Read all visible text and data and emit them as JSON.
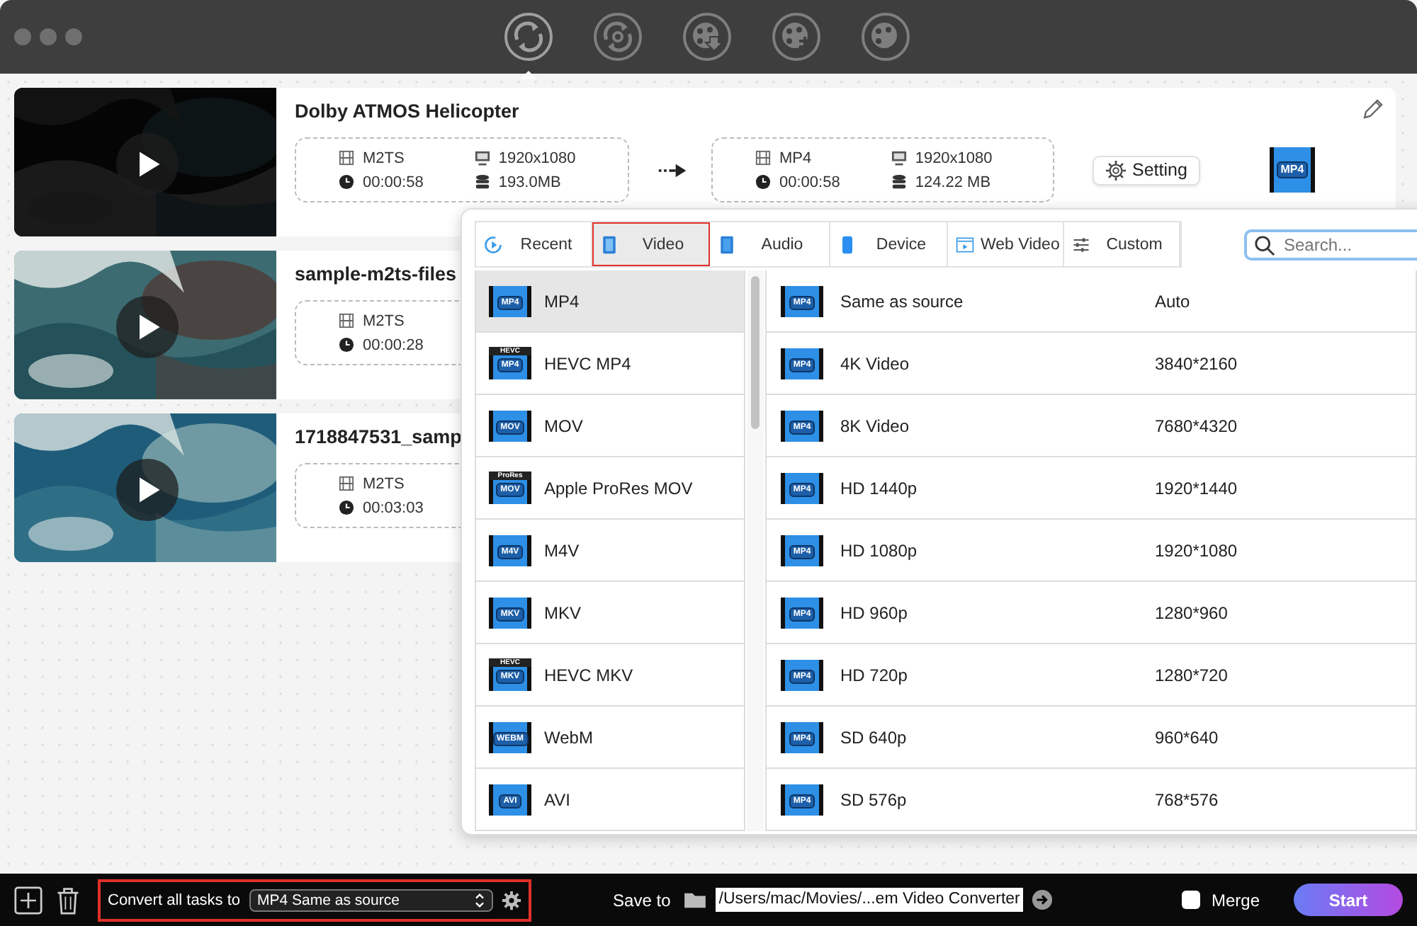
{
  "toolbar": [
    {
      "kind": "convert",
      "selected": true
    },
    {
      "kind": "compress",
      "selected": false
    },
    {
      "kind": "download",
      "selected": false
    },
    {
      "kind": "merge",
      "selected": false
    },
    {
      "kind": "edit",
      "selected": false
    }
  ],
  "tasks": [
    {
      "title": "Dolby ATMOS Helicopter",
      "source": {
        "format": "M2TS",
        "duration": "00:00:58",
        "resolution": "1920x1080",
        "size": "193.0MB"
      },
      "target": {
        "format": "MP4",
        "duration": "00:00:58",
        "resolution": "1920x1080",
        "size": "124.22 MB",
        "setting": "Setting",
        "badge": "MP4"
      }
    },
    {
      "title": "sample-m2ts-files",
      "source": {
        "format": "M2TS",
        "duration": "00:00:28"
      }
    },
    {
      "title": "1718847531_samp",
      "source": {
        "format": "M2TS",
        "duration": "00:03:03"
      }
    }
  ],
  "format_panel": {
    "tabs": [
      {
        "kind": "recent",
        "label": "Recent",
        "selected": false
      },
      {
        "kind": "video",
        "label": "Video",
        "selected": true
      },
      {
        "kind": "audio",
        "label": "Audio",
        "selected": false
      },
      {
        "kind": "device",
        "label": "Device",
        "selected": false
      },
      {
        "kind": "web",
        "label": "Web Video",
        "selected": false
      },
      {
        "kind": "custom",
        "label": "Custom",
        "selected": false
      }
    ],
    "search": {
      "placeholder": "Search..."
    },
    "formats": [
      {
        "name": "MP4",
        "badge": "MP4",
        "selected": true
      },
      {
        "name": "HEVC MP4",
        "badge": "MP4",
        "badge_top": "HEVC",
        "selected": false
      },
      {
        "name": "MOV",
        "badge": "MOV",
        "selected": false
      },
      {
        "name": "Apple ProRes MOV",
        "badge": "MOV",
        "badge_top": "ProRes",
        "selected": false
      },
      {
        "name": "M4V",
        "badge": "M4V",
        "selected": false
      },
      {
        "name": "MKV",
        "badge": "MKV",
        "selected": false
      },
      {
        "name": "HEVC MKV",
        "badge": "MKV",
        "badge_top": "HEVC",
        "selected": false
      },
      {
        "name": "WebM",
        "badge": "WEBM",
        "selected": false
      },
      {
        "name": "AVI",
        "badge": "AVI",
        "selected": false
      }
    ],
    "presets": [
      {
        "name": "Same as source",
        "resolution": "Auto",
        "badge": "MP4"
      },
      {
        "name": "4K Video",
        "resolution": "3840*2160",
        "badge": "MP4"
      },
      {
        "name": "8K Video",
        "resolution": "7680*4320",
        "badge": "MP4"
      },
      {
        "name": "HD 1440p",
        "resolution": "1920*1440",
        "badge": "MP4"
      },
      {
        "name": "HD 1080p",
        "resolution": "1920*1080",
        "badge": "MP4"
      },
      {
        "name": "HD 960p",
        "resolution": "1280*960",
        "badge": "MP4"
      },
      {
        "name": "HD 720p",
        "resolution": "1280*720",
        "badge": "MP4"
      },
      {
        "name": "SD 640p",
        "resolution": "960*640",
        "badge": "MP4"
      },
      {
        "name": "SD 576p",
        "resolution": "768*576",
        "badge": "MP4"
      }
    ]
  },
  "bottom_bar": {
    "convert_label": "Convert all tasks to",
    "convert_value": "MP4 Same as source",
    "save_label": "Save to",
    "save_path": "/Users/mac/Movies/...em Video Converter",
    "merge": {
      "label": "Merge",
      "checked": false
    },
    "start": "Start"
  }
}
